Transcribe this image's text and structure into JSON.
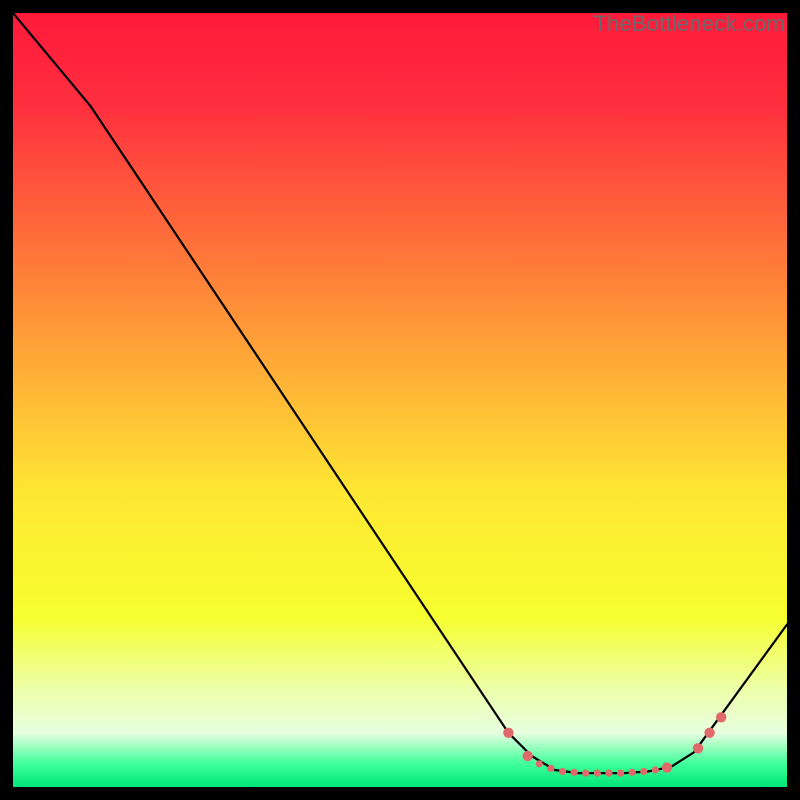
{
  "watermark": "TheBottleneck.com",
  "chart_data": {
    "type": "line",
    "title": "",
    "xlabel": "",
    "ylabel": "",
    "xlim": [
      0,
      100
    ],
    "ylim": [
      0,
      100
    ],
    "grid": false,
    "legend": false,
    "gradient_stops": [
      {
        "offset": 0.0,
        "color": "#ff1a3a"
      },
      {
        "offset": 0.12,
        "color": "#ff2f3f"
      },
      {
        "offset": 0.28,
        "color": "#ff6a3a"
      },
      {
        "offset": 0.45,
        "color": "#ffa937"
      },
      {
        "offset": 0.62,
        "color": "#ffe733"
      },
      {
        "offset": 0.78,
        "color": "#f6ff2f"
      },
      {
        "offset": 0.88,
        "color": "#ecffb0"
      },
      {
        "offset": 0.93,
        "color": "#e8ffe0"
      },
      {
        "offset": 0.97,
        "color": "#3fff9a"
      },
      {
        "offset": 1.0,
        "color": "#00e676"
      }
    ],
    "series": [
      {
        "name": "bottleneck-curve",
        "color": "#000000",
        "x": [
          0,
          10,
          64,
          67,
          70,
          73,
          76,
          79,
          82,
          85,
          88,
          100
        ],
        "y": [
          100,
          88,
          7,
          4,
          2.2,
          1.8,
          1.8,
          1.8,
          2.0,
          2.6,
          4.5,
          21
        ]
      }
    ],
    "markers": {
      "name": "highlight-dots",
      "color": "#e06a6a",
      "radius_primary": 5.2,
      "radius_secondary": 3.6,
      "points": [
        {
          "x": 64.0,
          "y": 7.0,
          "r": "primary"
        },
        {
          "x": 66.5,
          "y": 4.0,
          "r": "primary"
        },
        {
          "x": 68.0,
          "y": 3.0,
          "r": "secondary"
        },
        {
          "x": 69.5,
          "y": 2.4,
          "r": "secondary"
        },
        {
          "x": 71.0,
          "y": 2.0,
          "r": "secondary"
        },
        {
          "x": 72.5,
          "y": 1.9,
          "r": "secondary"
        },
        {
          "x": 74.0,
          "y": 1.8,
          "r": "secondary"
        },
        {
          "x": 75.5,
          "y": 1.8,
          "r": "secondary"
        },
        {
          "x": 77.0,
          "y": 1.8,
          "r": "secondary"
        },
        {
          "x": 78.5,
          "y": 1.8,
          "r": "secondary"
        },
        {
          "x": 80.0,
          "y": 1.9,
          "r": "secondary"
        },
        {
          "x": 81.5,
          "y": 2.0,
          "r": "secondary"
        },
        {
          "x": 83.0,
          "y": 2.2,
          "r": "secondary"
        },
        {
          "x": 84.5,
          "y": 2.5,
          "r": "primary"
        },
        {
          "x": 88.5,
          "y": 5.0,
          "r": "primary"
        },
        {
          "x": 90.0,
          "y": 7.0,
          "r": "primary"
        },
        {
          "x": 91.5,
          "y": 9.0,
          "r": "primary"
        }
      ]
    }
  }
}
